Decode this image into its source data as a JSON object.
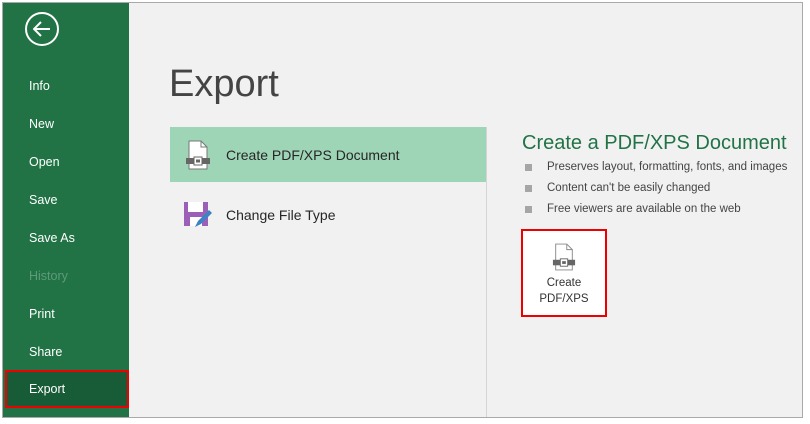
{
  "sidebar": {
    "back_icon": "arrow-left-circle-icon",
    "items": [
      {
        "label": "Info",
        "state": "normal"
      },
      {
        "label": "New",
        "state": "normal"
      },
      {
        "label": "Open",
        "state": "normal"
      },
      {
        "label": "Save",
        "state": "normal"
      },
      {
        "label": "Save As",
        "state": "normal"
      },
      {
        "label": "History",
        "state": "disabled"
      },
      {
        "label": "Print",
        "state": "normal"
      },
      {
        "label": "Share",
        "state": "normal"
      },
      {
        "label": "Export",
        "state": "selected"
      }
    ]
  },
  "main": {
    "title": "Export",
    "options": [
      {
        "label": "Create PDF/XPS Document",
        "icon": "pdf-document-icon",
        "selected": true
      },
      {
        "label": "Change File Type",
        "icon": "save-edit-icon",
        "selected": false
      }
    ]
  },
  "detail": {
    "title": "Create a PDF/XPS Document",
    "bullets": [
      "Preserves layout, formatting, fonts, and images",
      "Content can't be easily changed",
      "Free viewers are available on the web"
    ],
    "button": {
      "line1": "Create",
      "line2": "PDF/XPS",
      "icon": "pdf-document-icon"
    }
  },
  "colors": {
    "brand": "#217346",
    "selected_nav": "#185c37",
    "selected_option": "#9fd5b7",
    "highlight_border": "#ee0000"
  }
}
